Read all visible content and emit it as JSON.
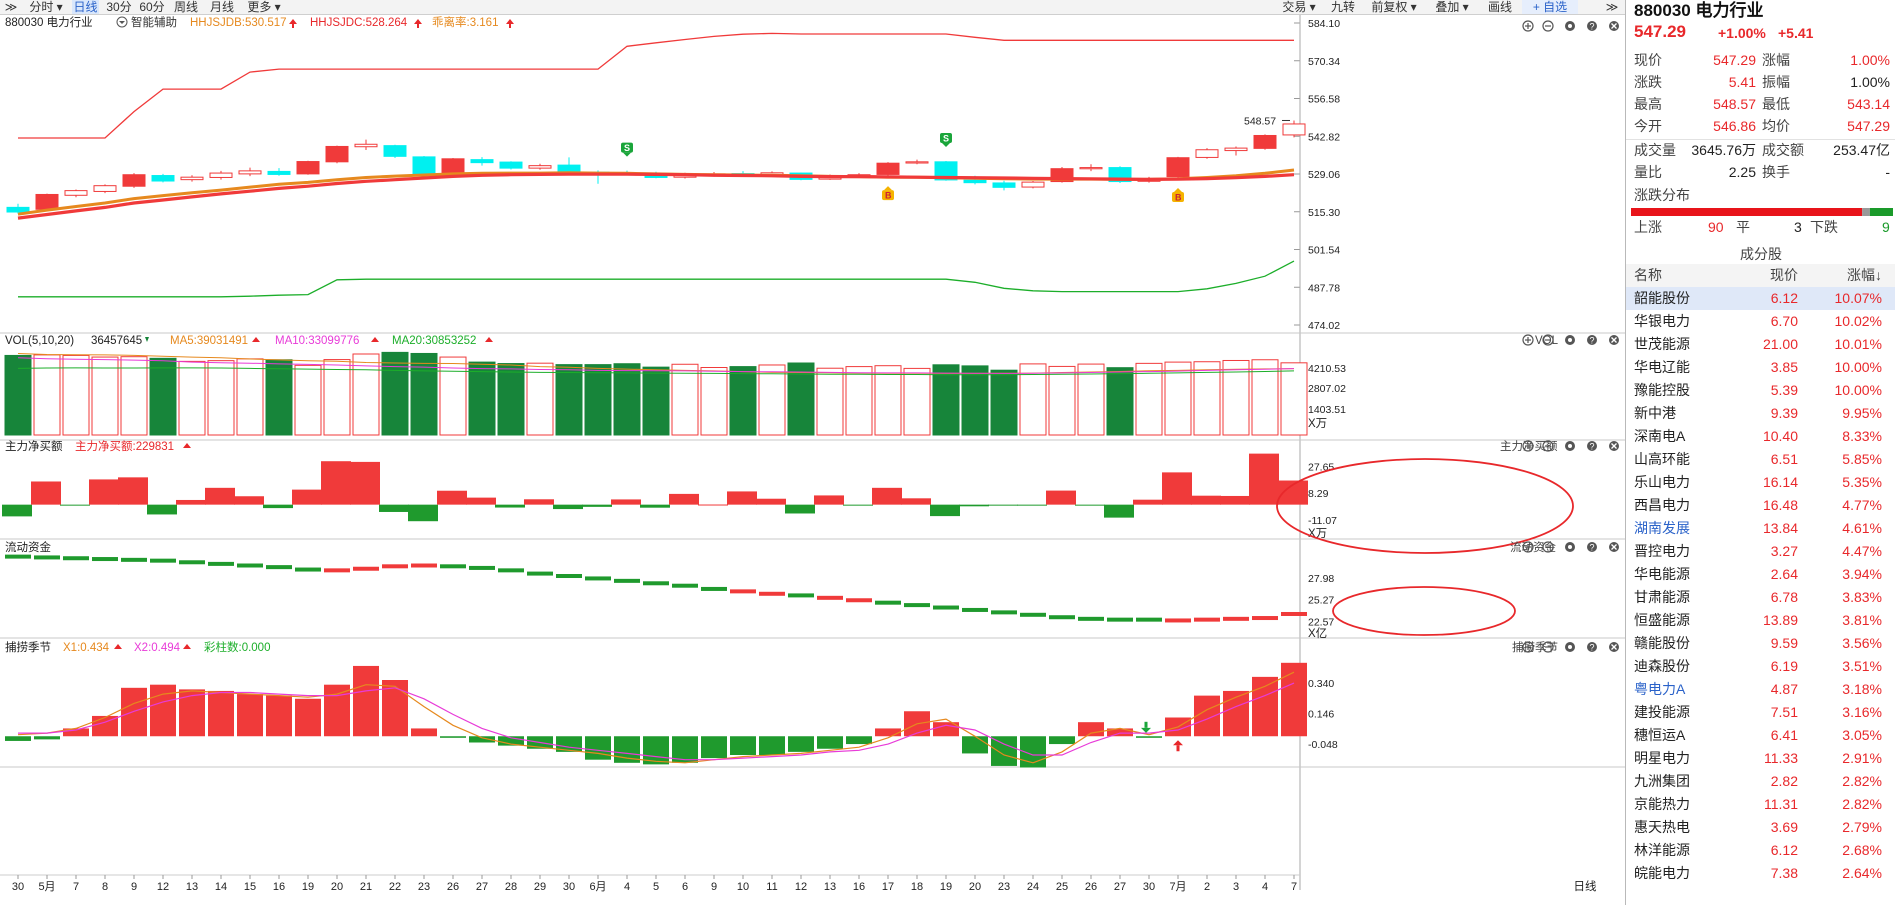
{
  "toolbar": {
    "left": [
      {
        "id": "collapse",
        "label": "≫"
      },
      {
        "id": "fenshi",
        "label": "分时 ▾"
      },
      {
        "id": "rixian",
        "label": "日线"
      },
      {
        "id": "m30",
        "label": "30分"
      },
      {
        "id": "m60",
        "label": "60分"
      },
      {
        "id": "zhouxian",
        "label": "周线"
      },
      {
        "id": "yuexian",
        "label": "月线"
      },
      {
        "id": "more",
        "label": "更多 ▾"
      }
    ],
    "right": [
      {
        "id": "jiaoyi",
        "label": "交易 ▾"
      },
      {
        "id": "jiuzhuan",
        "label": "九转"
      },
      {
        "id": "qianfuquan",
        "label": "前复权 ▾"
      },
      {
        "id": "diejia",
        "label": "叠加 ▾"
      },
      {
        "id": "huaxian",
        "label": "画线"
      },
      {
        "id": "zixuan",
        "label": "+ 自选"
      },
      {
        "id": "expand",
        "label": "≫"
      }
    ]
  },
  "main_header": {
    "code_name": "880030 电力行业",
    "assist": "智能辅助",
    "ind1": "HHJSJDB:530.517",
    "ind2": "HHJSJDC:528.264",
    "ind3": "乖离率:3.161",
    "high_mark": "548.57",
    "signal_sell": "S",
    "signal_buy": "B"
  },
  "vol_header": {
    "name": "VOL(5,10,20)",
    "v": "36457645",
    "ma5": "MA5:39031491",
    "ma10": "MA10:33099776",
    "ma20": "MA20:30853252",
    "tag": "VOL",
    "unit": "X万"
  },
  "zl_header": {
    "name": "主力净买额",
    "val": "主力净买额:229831",
    "tag": "主力净买额",
    "unit": "X万"
  },
  "ld_header": {
    "name": "流动资金",
    "tag": "流动资金",
    "unit": "X亿"
  },
  "bz_header": {
    "name": "捕捞季节",
    "x1": "X1:0.434",
    "x2": "X2:0.494",
    "bar": "彩柱数:0.000",
    "tag": "捕捞季节",
    "axis_label": "日线"
  },
  "colors": {
    "up": "#f03a3a",
    "down": "#17853a",
    "cyan": "#00f0f0",
    "orange": "#e6891e",
    "pink": "#e83bd8",
    "upper_band": "#f03a3a",
    "lower_band": "#1cae2a",
    "annot": "#e8282b"
  },
  "chart_data": {
    "dates": [
      "30",
      "5月",
      "7",
      "8",
      "9",
      "12",
      "13",
      "14",
      "15",
      "16",
      "19",
      "20",
      "21",
      "22",
      "23",
      "26",
      "27",
      "28",
      "29",
      "30",
      "6月",
      "4",
      "5",
      "6",
      "9",
      "10",
      "11",
      "12",
      "13",
      "16",
      "17",
      "18",
      "19",
      "20",
      "23",
      "24",
      "25",
      "26",
      "27",
      "30",
      "7月",
      "2",
      "3",
      "4",
      "7"
    ],
    "price_axis": [
      "584.10",
      "570.34",
      "556.58",
      "542.82",
      "529.06",
      "515.30",
      "501.54",
      "487.78",
      "474.02"
    ],
    "price_range": [
      474.02,
      584.1
    ],
    "candles": [
      [
        516.9,
        518.2,
        514.6,
        515.2
      ],
      [
        516.2,
        521.9,
        515.6,
        521.6
      ],
      [
        521.3,
        523.4,
        520.6,
        523.0
      ],
      [
        522.7,
        525.3,
        522.1,
        524.8
      ],
      [
        524.6,
        529.4,
        524.0,
        528.8
      ],
      [
        528.5,
        529.1,
        526.0,
        526.5
      ],
      [
        527.0,
        528.6,
        526.3,
        527.9
      ],
      [
        527.8,
        530.2,
        527.0,
        529.4
      ],
      [
        529.1,
        531.4,
        528.3,
        530.2
      ],
      [
        530.0,
        531.2,
        528.4,
        528.9
      ],
      [
        529.1,
        533.9,
        528.8,
        533.6
      ],
      [
        533.5,
        539.4,
        533.0,
        539.1
      ],
      [
        539.0,
        541.6,
        537.8,
        539.9
      ],
      [
        539.4,
        539.7,
        534.9,
        535.5
      ],
      [
        535.3,
        535.6,
        528.7,
        529.0
      ],
      [
        529.2,
        534.9,
        528.9,
        534.6
      ],
      [
        534.3,
        535.2,
        532.1,
        533.2
      ],
      [
        533.4,
        533.7,
        530.7,
        531.2
      ],
      [
        531.2,
        532.8,
        530.6,
        532.1
      ],
      [
        532.3,
        535.1,
        528.8,
        529.8
      ],
      [
        529.7,
        530.4,
        525.5,
        529.5
      ],
      [
        529.4,
        530.3,
        528.5,
        529.2
      ],
      [
        529.1,
        529.9,
        527.5,
        527.8
      ],
      [
        527.9,
        529.5,
        527.4,
        528.7
      ],
      [
        528.8,
        529.8,
        528.1,
        529.1
      ],
      [
        529.2,
        530.1,
        528.4,
        528.7
      ],
      [
        528.8,
        530.0,
        528.2,
        529.5
      ],
      [
        529.4,
        529.6,
        526.8,
        527.1
      ],
      [
        527.2,
        528.9,
        526.9,
        528.3
      ],
      [
        528.2,
        529.4,
        527.6,
        528.8
      ],
      [
        528.9,
        533.4,
        528.3,
        533.0
      ],
      [
        533.1,
        534.3,
        532.6,
        533.5
      ],
      [
        533.5,
        533.8,
        526.6,
        526.9
      ],
      [
        526.8,
        528.4,
        525.3,
        525.9
      ],
      [
        525.8,
        526.6,
        523.1,
        524.2
      ],
      [
        524.3,
        526.5,
        523.8,
        526.1
      ],
      [
        526.3,
        531.6,
        525.9,
        531.0
      ],
      [
        531.2,
        532.6,
        530.1,
        531.4
      ],
      [
        531.4,
        531.9,
        525.8,
        526.3
      ],
      [
        526.4,
        528.0,
        525.9,
        527.4
      ],
      [
        528.1,
        535.3,
        527.6,
        535.0
      ],
      [
        535.1,
        538.5,
        534.6,
        537.9
      ],
      [
        537.6,
        539.1,
        535.8,
        538.5
      ],
      [
        538.4,
        543.5,
        537.9,
        543.1
      ],
      [
        543.3,
        548.57,
        542.4,
        547.3
      ]
    ],
    "upper_band": [
      542.2,
      542.2,
      542.2,
      542.2,
      551.8,
      560.0,
      560.0,
      560.0,
      566.2,
      567.3,
      567.3,
      567.3,
      567.3,
      567.3,
      567.3,
      567.3,
      567.3,
      567.3,
      567.3,
      567.3,
      567.3,
      575.6,
      576.9,
      578.1,
      579.2,
      580.0,
      580.3,
      580.1,
      580.1,
      580.1,
      580.1,
      580.1,
      580.1,
      578.9,
      577.8,
      577.8,
      577.8,
      577.8,
      577.8,
      577.8,
      577.8,
      577.8,
      577.8,
      577.8,
      577.8
    ],
    "lower_band": [
      484.3,
      484.3,
      484.3,
      484.3,
      484.3,
      484.3,
      484.3,
      484.3,
      484.5,
      484.9,
      485.1,
      490.5,
      490.7,
      490.7,
      490.7,
      490.7,
      490.7,
      490.7,
      490.7,
      490.7,
      490.7,
      490.7,
      490.7,
      490.7,
      490.7,
      490.7,
      490.7,
      490.7,
      490.7,
      490.7,
      490.7,
      490.7,
      490.7,
      489.6,
      487.4,
      486.5,
      486.2,
      486.2,
      486.2,
      486.2,
      486.2,
      487.2,
      489.2,
      491.8,
      497.3
    ],
    "ma_red": [
      513.0,
      514.3,
      515.6,
      516.9,
      518.5,
      519.6,
      520.7,
      521.8,
      522.8,
      523.8,
      524.6,
      525.6,
      526.4,
      527.0,
      527.6,
      528.2,
      528.6,
      528.8,
      528.9,
      529.0,
      529.0,
      529.0,
      528.9,
      528.8,
      528.6,
      528.5,
      528.4,
      528.2,
      528.1,
      528.1,
      528.0,
      527.9,
      527.8,
      527.7,
      527.6,
      527.5,
      527.4,
      527.3,
      527.2,
      527.1,
      527.2,
      527.4,
      527.7,
      528.2,
      528.8
    ],
    "ma_orange": [
      514.4,
      515.9,
      517.2,
      518.5,
      520.1,
      521.2,
      522.2,
      523.2,
      524.3,
      525.3,
      526.0,
      527.0,
      527.8,
      528.3,
      528.7,
      529.1,
      529.3,
      529.4,
      529.4,
      529.5,
      529.4,
      529.3,
      529.1,
      528.9,
      528.8,
      528.7,
      528.6,
      528.4,
      528.2,
      528.1,
      527.9,
      527.9,
      527.7,
      527.5,
      527.3,
      527.2,
      527.2,
      527.2,
      527.1,
      527.1,
      527.3,
      527.8,
      528.4,
      529.3,
      530.5
    ],
    "sell_signals": [
      21,
      32
    ],
    "buy_signals": [
      30,
      40
    ],
    "vol_axis": [
      "4210.53",
      "2807.02",
      "1403.51"
    ],
    "vol_range": [
      0,
      5000
    ],
    "volume": [
      4420,
      4450,
      4420,
      4330,
      4350,
      4260,
      4090,
      4130,
      4230,
      4180,
      3870,
      4190,
      4500,
      4590,
      4530,
      4330,
      4050,
      3970,
      3990,
      3910,
      3910,
      3960,
      3770,
      3930,
      3750,
      3800,
      3890,
      4000,
      3710,
      3800,
      3850,
      3700,
      3900,
      3840,
      3600,
      3950,
      3810,
      3940,
      3740,
      3980,
      4050,
      4070,
      4140,
      4180,
      4010
    ],
    "vol_ma_a": [
      4530,
      4470,
      4460,
      4450,
      4420,
      4380,
      4330,
      4290,
      4220,
      4170,
      4130,
      4100,
      4030,
      4000,
      3980,
      3970,
      3930,
      3890,
      3800,
      3760,
      3700,
      3660,
      3620,
      3590,
      3560,
      3520,
      3480,
      3470,
      3460,
      3440,
      3430,
      3430,
      3420,
      3420,
      3430,
      3440,
      3470,
      3500,
      3530,
      3570,
      3590,
      3630,
      3650,
      3670,
      3690
    ],
    "vol_ma_b": [
      4290,
      4240,
      4210,
      4190,
      4160,
      4120,
      4050,
      4010,
      3990,
      3950,
      3920,
      3890,
      3840,
      3800,
      3770,
      3720,
      3690,
      3670,
      3640,
      3620,
      3590,
      3580,
      3570,
      3560,
      3540,
      3520,
      3510,
      3500,
      3480,
      3460,
      3450,
      3450,
      3440,
      3430,
      3420,
      3430,
      3450,
      3470,
      3500,
      3520,
      3550,
      3590,
      3620,
      3650,
      3690
    ],
    "vol_ma_c": [
      3700,
      3720,
      3730,
      3720,
      3720,
      3730,
      3730,
      3720,
      3700,
      3680,
      3660,
      3640,
      3620,
      3590,
      3560,
      3540,
      3520,
      3500,
      3480,
      3470,
      3460,
      3450,
      3440,
      3430,
      3420,
      3410,
      3400,
      3390,
      3380,
      3370,
      3360,
      3360,
      3350,
      3350,
      3350,
      3360,
      3370,
      3390,
      3410,
      3430,
      3450,
      3480,
      3500,
      3530,
      3560
    ],
    "zl_axis": [
      "27.65",
      "8.29",
      "-11.07"
    ],
    "zl_range": [
      -22,
      36
    ],
    "zl_values": [
      -8.5,
      16.8,
      -0.3,
      18.3,
      19.8,
      -7.1,
      3.4,
      12.2,
      6.1,
      -2.5,
      10.9,
      31.5,
      31.0,
      -5.3,
      -12.0,
      10.1,
      5.1,
      -2.1,
      3.9,
      -3.2,
      -1.6,
      3.8,
      -2.2,
      7.8,
      0.1,
      9.6,
      4.3,
      -6.4,
      6.7,
      -0.5,
      12.2,
      4.6,
      -8.3,
      -1.2,
      -0.6,
      -0.4,
      10.2,
      -0.4,
      -9.4,
      3.6,
      23.4,
      6.5,
      6.3,
      37.0,
      17.5
    ],
    "ld_axis": [
      "27.98",
      "25.27",
      "22.57"
    ],
    "ld_range": [
      20.9,
      30.8
    ],
    "ld_values": [
      30.6,
      30.5,
      30.4,
      30.3,
      30.2,
      30.1,
      29.9,
      29.7,
      29.5,
      29.3,
      29.0,
      28.9,
      29.1,
      29.4,
      29.5,
      29.4,
      29.2,
      28.9,
      28.5,
      28.2,
      27.9,
      27.6,
      27.3,
      27.0,
      26.6,
      26.3,
      26.0,
      25.8,
      25.5,
      25.2,
      24.9,
      24.6,
      24.3,
      24.0,
      23.7,
      23.4,
      23.1,
      22.9,
      22.8,
      22.8,
      22.7,
      22.8,
      22.9,
      23.0,
      23.5
    ],
    "ld_up": [
      false,
      false,
      false,
      false,
      false,
      false,
      false,
      false,
      false,
      false,
      false,
      true,
      true,
      true,
      true,
      false,
      false,
      false,
      false,
      false,
      false,
      false,
      false,
      false,
      false,
      true,
      true,
      false,
      true,
      true,
      false,
      false,
      false,
      false,
      false,
      false,
      false,
      false,
      false,
      false,
      true,
      true,
      true,
      true,
      true
    ],
    "bz_axis": [
      "0.340",
      "0.146",
      "-0.048"
    ],
    "bz_range": [
      -0.12,
      0.52
    ],
    "bz_values": [
      -0.03,
      -0.02,
      0.05,
      0.13,
      0.31,
      0.33,
      0.3,
      0.29,
      0.27,
      0.26,
      0.24,
      0.33,
      0.45,
      0.36,
      0.05,
      -0.01,
      -0.04,
      -0.06,
      -0.08,
      -0.1,
      -0.15,
      -0.17,
      -0.18,
      -0.17,
      -0.14,
      -0.12,
      -0.12,
      -0.1,
      -0.08,
      -0.05,
      0.05,
      0.16,
      0.09,
      -0.11,
      -0.19,
      -0.2,
      -0.05,
      0.09,
      0.05,
      -0.01,
      0.12,
      0.26,
      0.29,
      0.38,
      0.47
    ],
    "bz_x1": [
      0.01,
      0.02,
      0.05,
      0.12,
      0.21,
      0.27,
      0.29,
      0.28,
      0.27,
      0.26,
      0.25,
      0.27,
      0.33,
      0.32,
      0.19,
      0.07,
      -0.01,
      -0.05,
      -0.07,
      -0.09,
      -0.11,
      -0.14,
      -0.16,
      -0.17,
      -0.15,
      -0.13,
      -0.12,
      -0.11,
      -0.09,
      -0.07,
      -0.01,
      0.08,
      0.11,
      0.0,
      -0.12,
      -0.17,
      -0.1,
      0.02,
      0.05,
      0.01,
      0.06,
      0.17,
      0.25,
      0.32,
      0.41
    ],
    "bz_x2": [
      0.02,
      0.02,
      0.04,
      0.09,
      0.16,
      0.22,
      0.26,
      0.28,
      0.28,
      0.27,
      0.26,
      0.26,
      0.29,
      0.31,
      0.24,
      0.14,
      0.05,
      -0.01,
      -0.04,
      -0.07,
      -0.09,
      -0.11,
      -0.13,
      -0.15,
      -0.15,
      -0.14,
      -0.13,
      -0.12,
      -0.1,
      -0.09,
      -0.05,
      0.02,
      0.07,
      0.04,
      -0.05,
      -0.12,
      -0.12,
      -0.04,
      0.02,
      0.02,
      0.04,
      0.11,
      0.19,
      0.26,
      0.34
    ],
    "bz_down_arrow": 39,
    "bz_up_arrow": 40
  },
  "quote": {
    "title": "880030 电力行业",
    "price": "547.29",
    "pct": "+1.00%",
    "chg": "+5.41",
    "rows": [
      {
        "l1": "现价",
        "v1": "547.29",
        "c1": "red",
        "l2": "涨幅",
        "v2": "1.00%",
        "c2": "red"
      },
      {
        "l1": "涨跌",
        "v1": "5.41",
        "c1": "red",
        "l2": "振幅",
        "v2": "1.00%",
        "c2": "blk"
      },
      {
        "l1": "最高",
        "v1": "548.57",
        "c1": "red",
        "l2": "最低",
        "v2": "543.14",
        "c2": "red"
      },
      {
        "l1": "今开",
        "v1": "546.86",
        "c1": "red",
        "l2": "均价",
        "v2": "547.29",
        "c2": "red"
      }
    ],
    "rows2": [
      {
        "l1": "成交量",
        "v1": "3645.76万",
        "c1": "blk",
        "l2": "成交额",
        "v2": "253.47亿",
        "c2": "blk"
      },
      {
        "l1": "量比",
        "v1": "2.25",
        "c1": "blk",
        "l2": "换手",
        "v2": "-",
        "c2": "blk"
      }
    ],
    "dist_title": "涨跌分布",
    "dist": {
      "up_label": "上涨",
      "up": "90",
      "flat_label": "平",
      "flat": "3",
      "down_label": "下跌",
      "down": "9"
    },
    "comp_title": "成分股",
    "col_name": "名称",
    "col_price": "现价",
    "col_pct": "涨幅↓",
    "stocks": [
      {
        "name": "韶能股份",
        "price": "6.12",
        "pct": "10.07%",
        "blue": false
      },
      {
        "name": "华银电力",
        "price": "6.70",
        "pct": "10.02%",
        "blue": false
      },
      {
        "name": "世茂能源",
        "price": "21.00",
        "pct": "10.01%",
        "blue": false
      },
      {
        "name": "华电辽能",
        "price": "3.85",
        "pct": "10.00%",
        "blue": false
      },
      {
        "name": "豫能控股",
        "price": "5.39",
        "pct": "10.00%",
        "blue": false
      },
      {
        "name": "新中港",
        "price": "9.39",
        "pct": "9.95%",
        "blue": false
      },
      {
        "name": "深南电A",
        "price": "10.40",
        "pct": "8.33%",
        "blue": false
      },
      {
        "name": "山高环能",
        "price": "6.51",
        "pct": "5.85%",
        "blue": false
      },
      {
        "name": "乐山电力",
        "price": "16.14",
        "pct": "5.35%",
        "blue": false
      },
      {
        "name": "西昌电力",
        "price": "16.48",
        "pct": "4.77%",
        "blue": false
      },
      {
        "name": "湖南发展",
        "price": "13.84",
        "pct": "4.61%",
        "blue": true
      },
      {
        "name": "晋控电力",
        "price": "3.27",
        "pct": "4.47%",
        "blue": false
      },
      {
        "name": "华电能源",
        "price": "2.64",
        "pct": "3.94%",
        "blue": false
      },
      {
        "name": "甘肃能源",
        "price": "6.78",
        "pct": "3.83%",
        "blue": false
      },
      {
        "name": "恒盛能源",
        "price": "13.89",
        "pct": "3.81%",
        "blue": false
      },
      {
        "name": "赣能股份",
        "price": "9.59",
        "pct": "3.56%",
        "blue": false
      },
      {
        "name": "迪森股份",
        "price": "6.19",
        "pct": "3.51%",
        "blue": false
      },
      {
        "name": "粤电力A",
        "price": "4.87",
        "pct": "3.18%",
        "blue": true
      },
      {
        "name": "建投能源",
        "price": "7.51",
        "pct": "3.16%",
        "blue": false
      },
      {
        "name": "穗恒运A",
        "price": "6.41",
        "pct": "3.05%",
        "blue": false
      },
      {
        "name": "明星电力",
        "price": "11.33",
        "pct": "2.91%",
        "blue": false
      },
      {
        "name": "九洲集团",
        "price": "2.82",
        "pct": "2.82%",
        "blue": false
      },
      {
        "name": "京能热力",
        "price": "11.31",
        "pct": "2.82%",
        "blue": false
      },
      {
        "name": "惠天热电",
        "price": "3.69",
        "pct": "2.79%",
        "blue": false
      },
      {
        "name": "林洋能源",
        "price": "6.12",
        "pct": "2.68%",
        "blue": false
      },
      {
        "name": "皖能电力",
        "price": "7.38",
        "pct": "2.64%",
        "blue": false
      }
    ]
  }
}
